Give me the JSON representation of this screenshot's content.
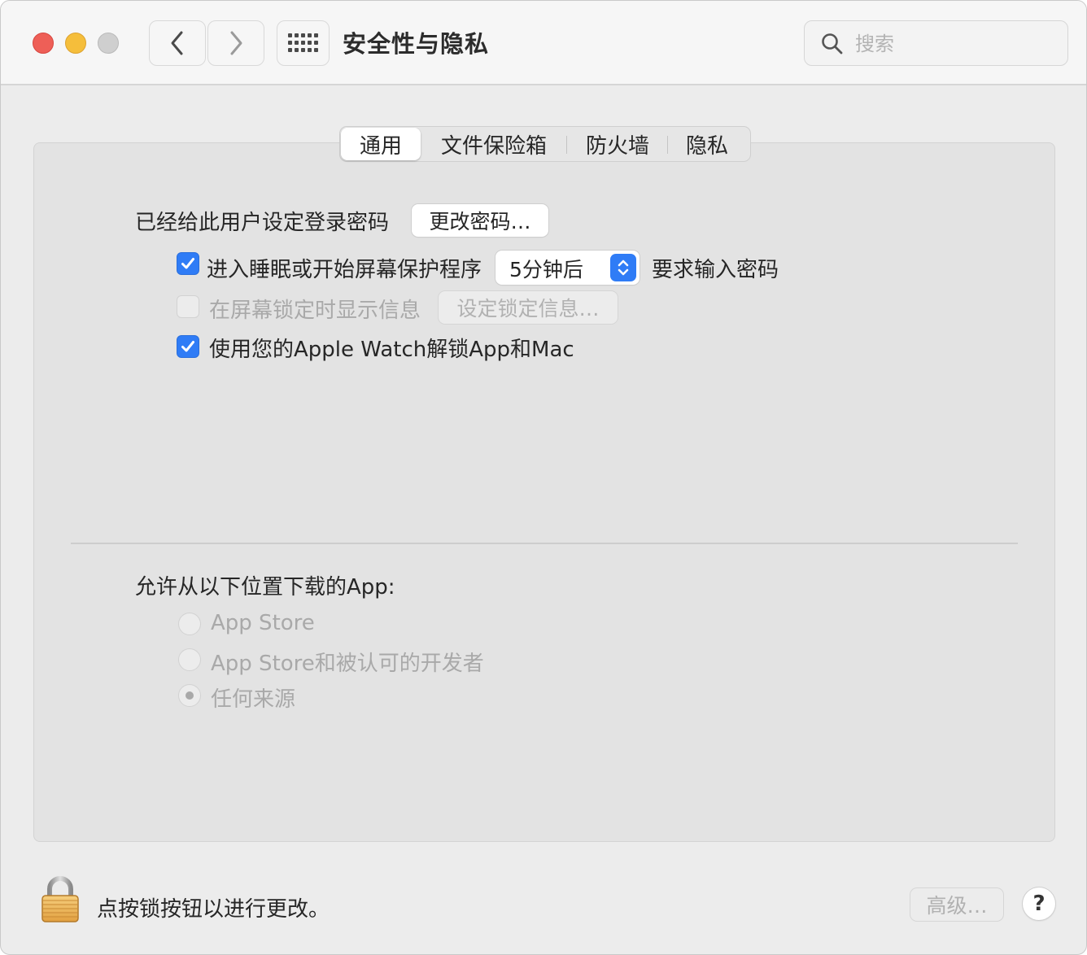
{
  "window": {
    "title": "安全性与隐私",
    "traffic_colors": {
      "close": "#ee5f57",
      "minimize": "#f5be3b",
      "zoom": "#cfcfcf"
    }
  },
  "toolbar": {
    "back_icon": "chevron-left-icon",
    "forward_icon": "chevron-right-icon",
    "grid_icon": "grid-icon"
  },
  "search": {
    "placeholder": "搜索",
    "value": "",
    "icon": "search-icon"
  },
  "tabs": [
    {
      "label": "通用",
      "active": true
    },
    {
      "label": "文件保险箱",
      "active": false
    },
    {
      "label": "防火墙",
      "active": false
    },
    {
      "label": "隐私",
      "active": false
    }
  ],
  "general": {
    "password_label": "已经给此用户设定登录密码",
    "change_password_button": "更改密码…",
    "require_password": {
      "checked": true,
      "label_before": "进入睡眠或开始屏幕保护程序",
      "delay_value": "5分钟后",
      "label_after": "要求输入密码"
    },
    "lock_message": {
      "checked": false,
      "disabled": true,
      "label": "在屏幕锁定时显示信息",
      "button": "设定锁定信息…"
    },
    "apple_watch": {
      "checked": true,
      "label": "使用您的Apple Watch解锁App和Mac"
    }
  },
  "downloads": {
    "title": "允许从以下位置下载的App:",
    "options": [
      {
        "label": "App Store",
        "selected": false,
        "disabled": true
      },
      {
        "label": "App Store和被认可的开发者",
        "selected": false,
        "disabled": true
      },
      {
        "label": "任何来源",
        "selected": true,
        "disabled": true
      }
    ]
  },
  "footer": {
    "lock_icon": "lock-icon",
    "lock_text": "点按锁按钮以进行更改。",
    "advanced_button": "高级…",
    "help_label": "?"
  },
  "colors": {
    "accent": "#2f7cf6",
    "window_bg": "#ececec",
    "panel_bg": "#e3e3e3"
  }
}
